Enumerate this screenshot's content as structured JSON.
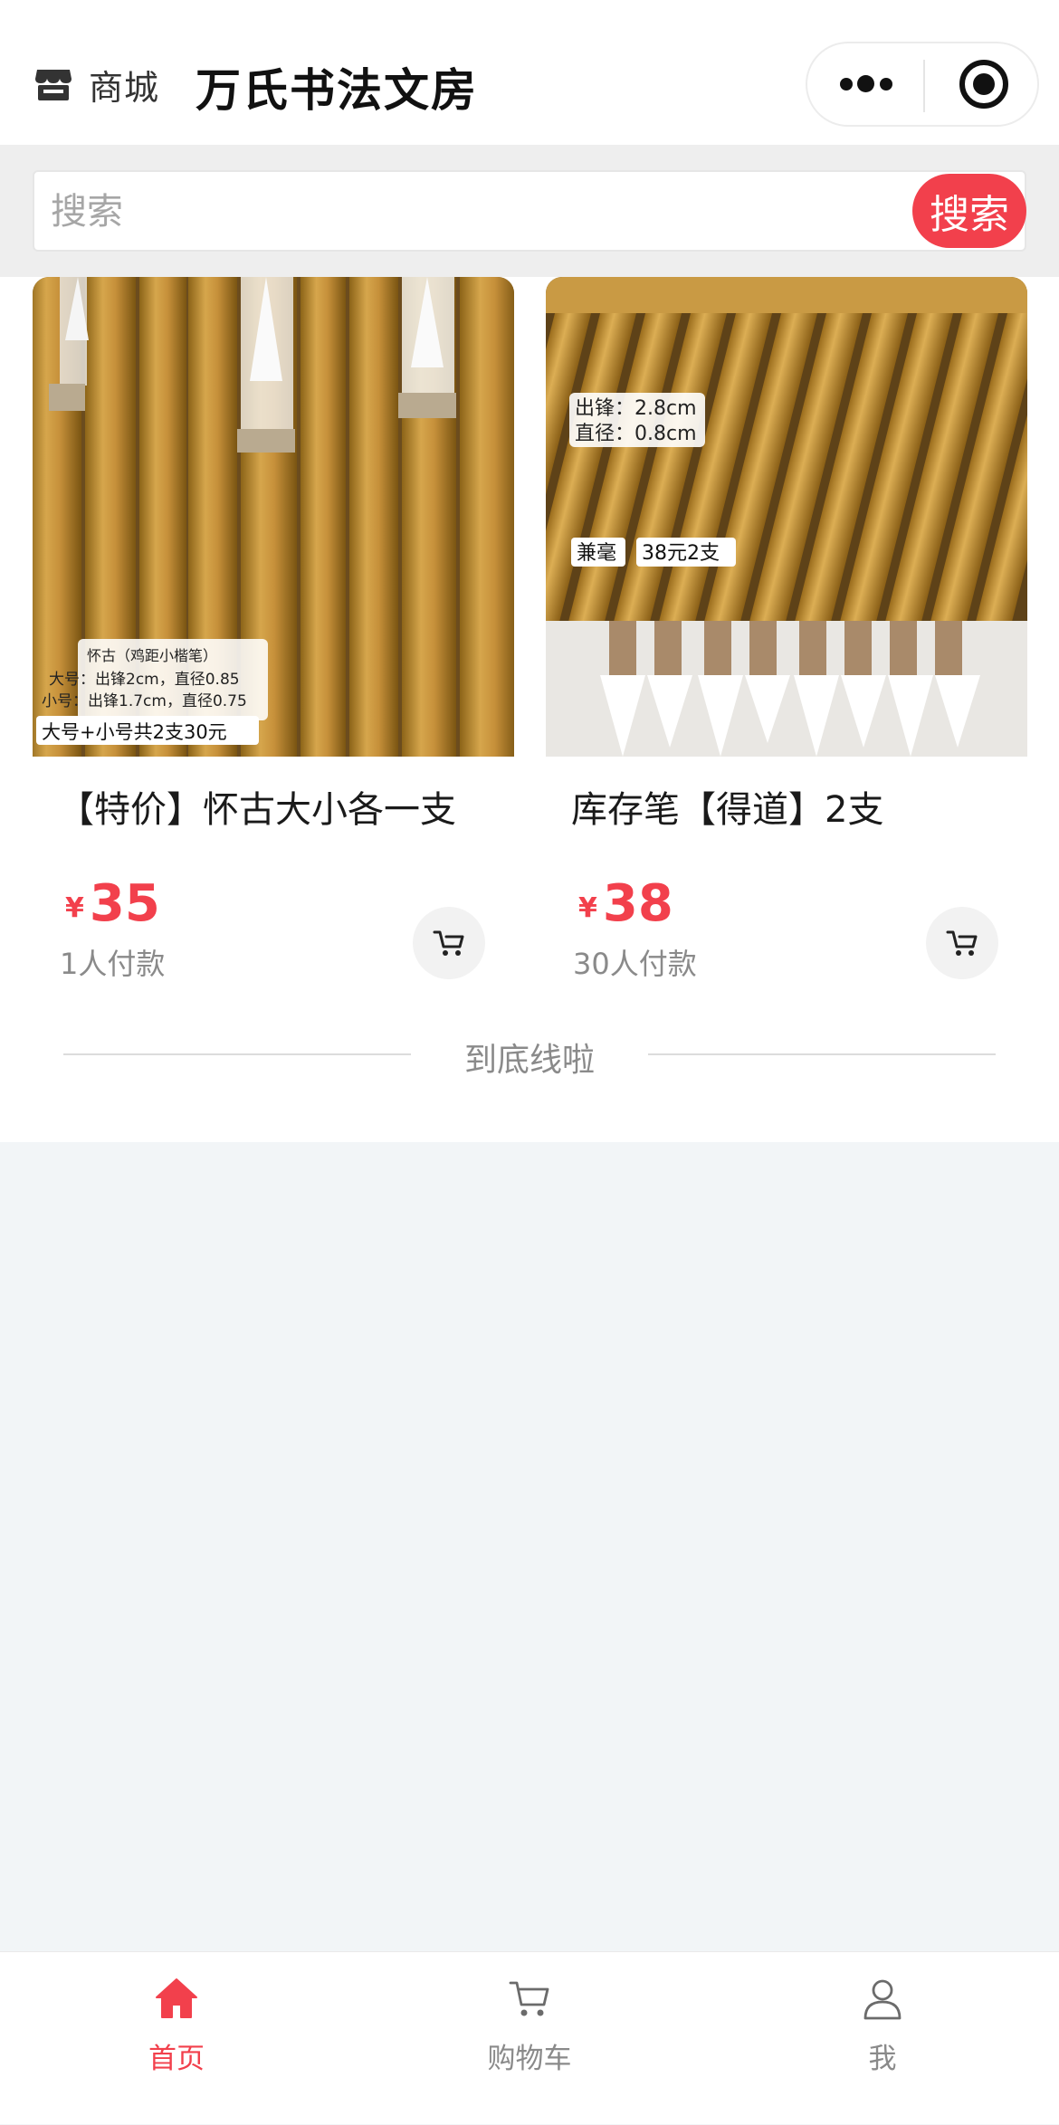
{
  "header": {
    "store_label": "商城",
    "title": "万氏书法文房",
    "icons": {
      "store": "store-icon",
      "more": "more-dots-icon",
      "target": "target-icon"
    }
  },
  "search": {
    "placeholder": "搜索",
    "button_label": "搜索"
  },
  "products": [
    {
      "title": "【特价】怀古大小各一支",
      "currency": "¥",
      "price": "35",
      "paid": "1人付款",
      "image_lines": [
        "怀古（鸡距小楷笔）",
        "大号：出锋2cm，直径0.85",
        "小号：出锋1.7cm，直径0.75"
      ],
      "image_tag": "大号+小号共2支30元"
    },
    {
      "title": "库存笔【得道】2支",
      "currency": "¥",
      "price": "38",
      "paid": "30人付款",
      "image_lines": [
        "出锋：2.8cm",
        "直径：0.8cm"
      ],
      "image_tag_a": "兼毫",
      "image_tag_b": "38元2支"
    }
  ],
  "end_text": "到底线啦",
  "tabbar": {
    "items": [
      {
        "label": "首页",
        "icon": "home-icon",
        "active": true
      },
      {
        "label": "购物车",
        "icon": "cart-icon",
        "active": false
      },
      {
        "label": "我",
        "icon": "user-icon",
        "active": false
      }
    ]
  },
  "colors": {
    "accent": "#f2404c",
    "muted_text": "#8a8a8a",
    "page_background": "#f2f5f7"
  }
}
